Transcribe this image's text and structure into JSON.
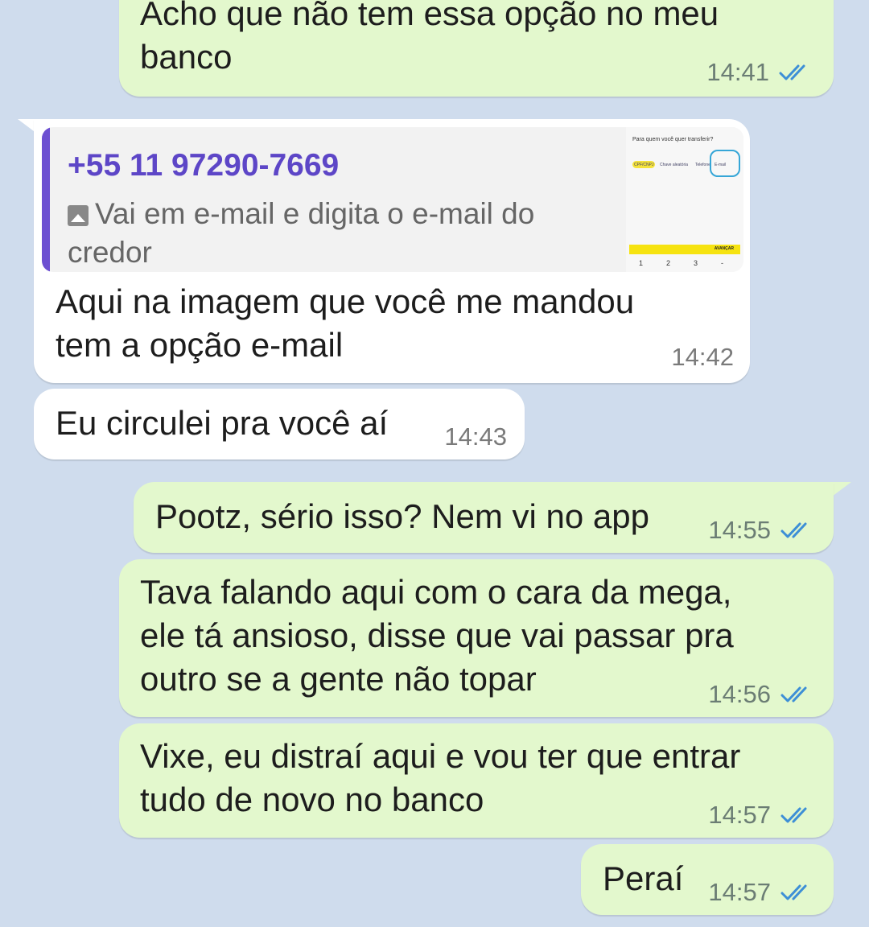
{
  "colors": {
    "background": "#cfdced",
    "outgoing_bubble": "#e3f8cd",
    "incoming_bubble": "#ffffff",
    "read_ticks": "#3d8fd6",
    "quote_accent": "#6c4fd1"
  },
  "messages": [
    {
      "direction": "out",
      "text": "Acho que não tem essa opção no meu\nbanco",
      "time": "14:41",
      "status": "read-double-check-icon"
    },
    {
      "direction": "in",
      "reply_to": {
        "sender": "+55 11 97290-7669",
        "text": "Vai em e-mail e digita o e-mail do credor",
        "icon": "image-icon",
        "thumbnail": {
          "title": "Para quem você quer transferir?",
          "options": [
            "CPF/CNPJ",
            "Chave aleatória",
            "Telefone",
            "E-mail"
          ],
          "button": "AVANÇAR",
          "keys": [
            "1",
            "2",
            "3",
            "-"
          ]
        }
      },
      "text": "Aqui na imagem que você me mandou\ntem a opção e-mail",
      "time": "14:42"
    },
    {
      "direction": "in",
      "text": "Eu circulei pra você aí",
      "time": "14:43"
    },
    {
      "direction": "out",
      "text": "Pootz, sério isso? Nem vi no app",
      "time": "14:55",
      "status": "read-double-check-icon"
    },
    {
      "direction": "out",
      "text": "Tava falando aqui com o cara da mega,\nele tá ansioso, disse que vai passar pra\noutro se a gente não topar",
      "time": "14:56",
      "status": "read-double-check-icon"
    },
    {
      "direction": "out",
      "text": "Vixe, eu distraí aqui e vou ter que entrar\ntudo de novo no banco",
      "time": "14:57",
      "status": "read-double-check-icon"
    },
    {
      "direction": "out",
      "text": "Peraí",
      "time": "14:57",
      "status": "read-double-check-icon"
    }
  ]
}
